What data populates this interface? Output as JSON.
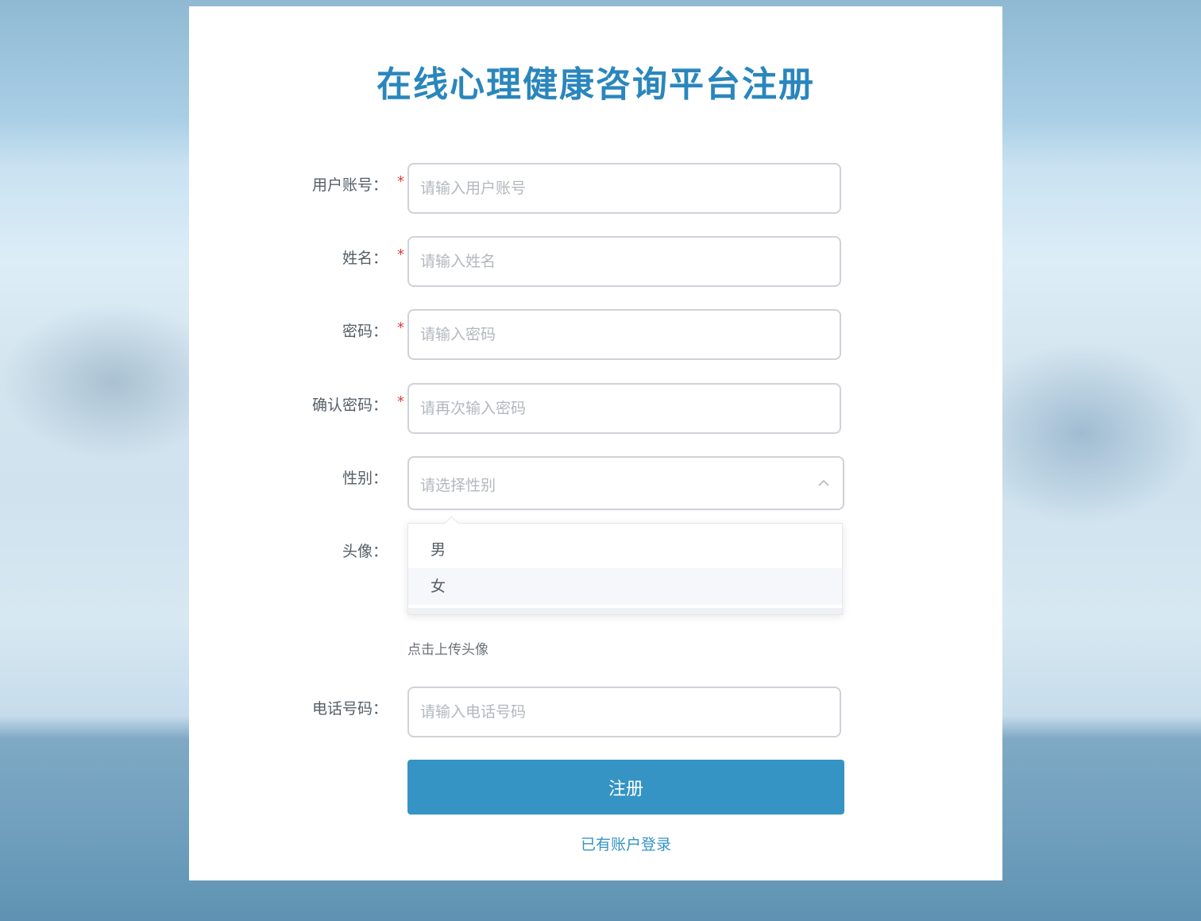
{
  "title": "在线心理健康咨询平台注册",
  "form": {
    "username": {
      "label": "用户账号：",
      "required": "*",
      "placeholder": "请输入用户账号"
    },
    "name": {
      "label": "姓名：",
      "required": "*",
      "placeholder": "请输入姓名"
    },
    "password": {
      "label": "密码：",
      "required": "*",
      "placeholder": "请输入密码"
    },
    "confirm_password": {
      "label": "确认密码：",
      "required": "*",
      "placeholder": "请再次输入密码"
    },
    "gender": {
      "label": "性别：",
      "placeholder": "请选择性别",
      "options": [
        "男",
        "女"
      ],
      "dropdown_open": true,
      "hovered_option": "女"
    },
    "avatar": {
      "label": "头像：",
      "upload_hint": "点击上传头像"
    },
    "phone": {
      "label": "电话号码：",
      "placeholder": "请输入电话号码"
    }
  },
  "submit_label": "注册",
  "login_link": "已有账户登录",
  "colors": {
    "accent": "#3594c3",
    "title": "#2a86bd",
    "required": "#e23c3c"
  },
  "icons": {
    "select_toggle": "chevron-up-icon"
  }
}
